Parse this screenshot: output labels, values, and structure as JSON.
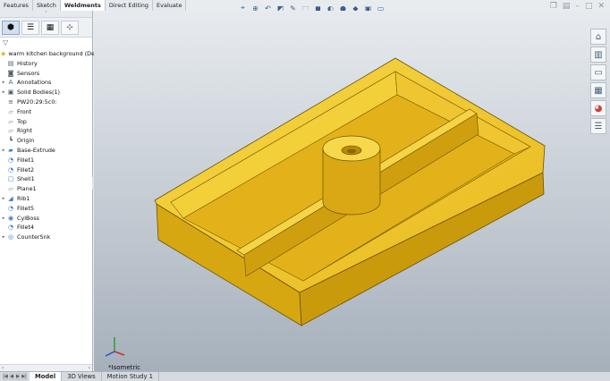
{
  "command_tabs": [
    {
      "label": "Features",
      "active": false
    },
    {
      "label": "Sketch",
      "active": false
    },
    {
      "label": "Weldments",
      "active": true
    },
    {
      "label": "Direct Editing",
      "active": false
    },
    {
      "label": "Evaluate",
      "active": false
    }
  ],
  "hud_icons": [
    "zoom-to-fit-icon",
    "zoom-area-icon",
    "previous-view-icon",
    "section-view-icon",
    "dynamic-annotation-icon",
    "view-orientation-icon",
    "display-style-icon",
    "hide-show-icon",
    "edit-appearance-icon",
    "apply-scene-icon",
    "view-settings-icon",
    "display-pane-icon"
  ],
  "window_controls": [
    "restore-icon",
    "tile-icon",
    "minimize-icon",
    "maximize-icon",
    "close-icon"
  ],
  "feature_manager": {
    "tabs": [
      "feature-manager-icon",
      "property-manager-icon",
      "configuration-manager-icon",
      "dimxpert-icon"
    ],
    "filter_icon": "filter-icon",
    "root_label": "warm kitchen background (Def",
    "items": [
      {
        "label": "History",
        "icon": "history-icon",
        "expandable": false
      },
      {
        "label": "Sensors",
        "icon": "sensors-icon",
        "expandable": false
      },
      {
        "label": "Annotations",
        "icon": "annotations-icon",
        "expandable": true
      },
      {
        "label": "Solid Bodies(1)",
        "icon": "solid-bodies-icon",
        "expandable": true
      },
      {
        "label": "PW20:29:5c0:",
        "icon": "material-icon",
        "expandable": false
      },
      {
        "label": "Front",
        "icon": "plane-icon",
        "expandable": false
      },
      {
        "label": "Top",
        "icon": "plane-icon",
        "expandable": false
      },
      {
        "label": "Right",
        "icon": "plane-icon",
        "expandable": false
      },
      {
        "label": "Origin",
        "icon": "origin-icon",
        "expandable": false
      },
      {
        "label": "Base-Extrude",
        "icon": "extrude-icon",
        "expandable": true
      },
      {
        "label": "Fillet1",
        "icon": "fillet-icon",
        "expandable": false
      },
      {
        "label": "Fillet2",
        "icon": "fillet-icon",
        "expandable": false
      },
      {
        "label": "Shell1",
        "icon": "shell-icon",
        "expandable": false
      },
      {
        "label": "Plane1",
        "icon": "plane-icon",
        "expandable": false
      },
      {
        "label": "Rib1",
        "icon": "rib-icon",
        "expandable": true
      },
      {
        "label": "Fillet5",
        "icon": "fillet-icon",
        "expandable": false
      },
      {
        "label": "CylBoss",
        "icon": "boss-icon",
        "expandable": true
      },
      {
        "label": "Fillet4",
        "icon": "fillet-icon",
        "expandable": false
      },
      {
        "label": "CounterSnk",
        "icon": "countersink-icon",
        "expandable": true
      }
    ]
  },
  "viewport": {
    "view_label": "*Isometric",
    "part_color": "#f2c82a",
    "background_top": "#e7ebef",
    "background_bottom": "#a6b0bb"
  },
  "task_pane": [
    "home-icon",
    "design-library-icon",
    "file-explorer-icon",
    "view-palette-icon",
    "appearances-icon",
    "custom-properties-icon"
  ],
  "bottom_tabs": [
    {
      "label": "Model",
      "active": true
    },
    {
      "label": "3D Views",
      "active": false
    },
    {
      "label": "Motion Study 1",
      "active": false
    }
  ]
}
